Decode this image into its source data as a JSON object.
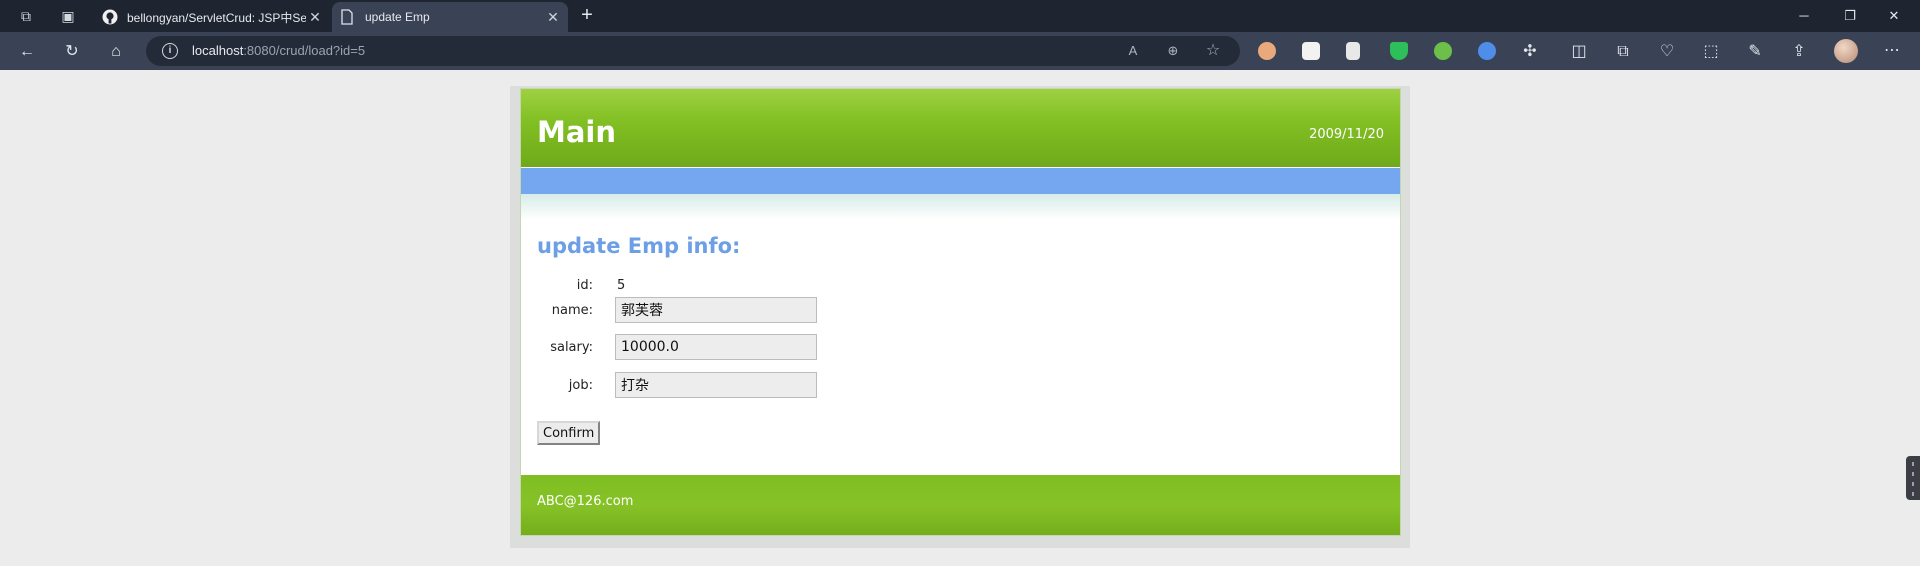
{
  "browser": {
    "tabs": [
      {
        "title": "bellongyan/ServletCrud: JSP中Se",
        "active": false
      },
      {
        "title": "update Emp",
        "active": true
      }
    ],
    "url_host": "localhost",
    "url_path": ":8080/crud/load?id=5"
  },
  "page": {
    "site_title": "Main",
    "date": "2009/11/20",
    "heading": "update Emp info:",
    "fields": {
      "id_label": "id:",
      "id_value": "5",
      "name_label": "name:",
      "name_value": "郭芙蓉",
      "salary_label": "salary:",
      "salary_value": "10000.0",
      "job_label": "job:",
      "job_value": "打杂"
    },
    "confirm_label": "Confirm",
    "footer_email": "ABC@126.com"
  },
  "colors": {
    "header_green": "#82c024",
    "nav_blue": "#74a7ef",
    "heading_blue": "#6c9fe5"
  }
}
